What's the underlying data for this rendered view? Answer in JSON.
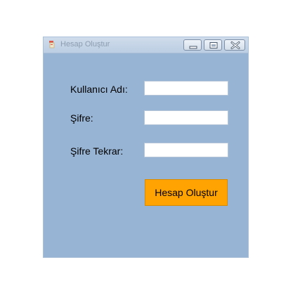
{
  "window": {
    "title": "Hesap Oluştur",
    "icons": {
      "app": "form-app-icon",
      "minimize": "minimize-icon",
      "maximize": "maximize-icon",
      "close": "close-icon"
    }
  },
  "form": {
    "username_label": "Kullanıcı Adı:",
    "username_value": "",
    "password_label": "Şifre:",
    "password_value": "",
    "password_repeat_label": "Şifre Tekrar:",
    "password_repeat_value": "",
    "submit_label": "Hesap Oluştur"
  },
  "colors": {
    "window_background": "#98b4d4",
    "button_background": "#ffa303"
  }
}
